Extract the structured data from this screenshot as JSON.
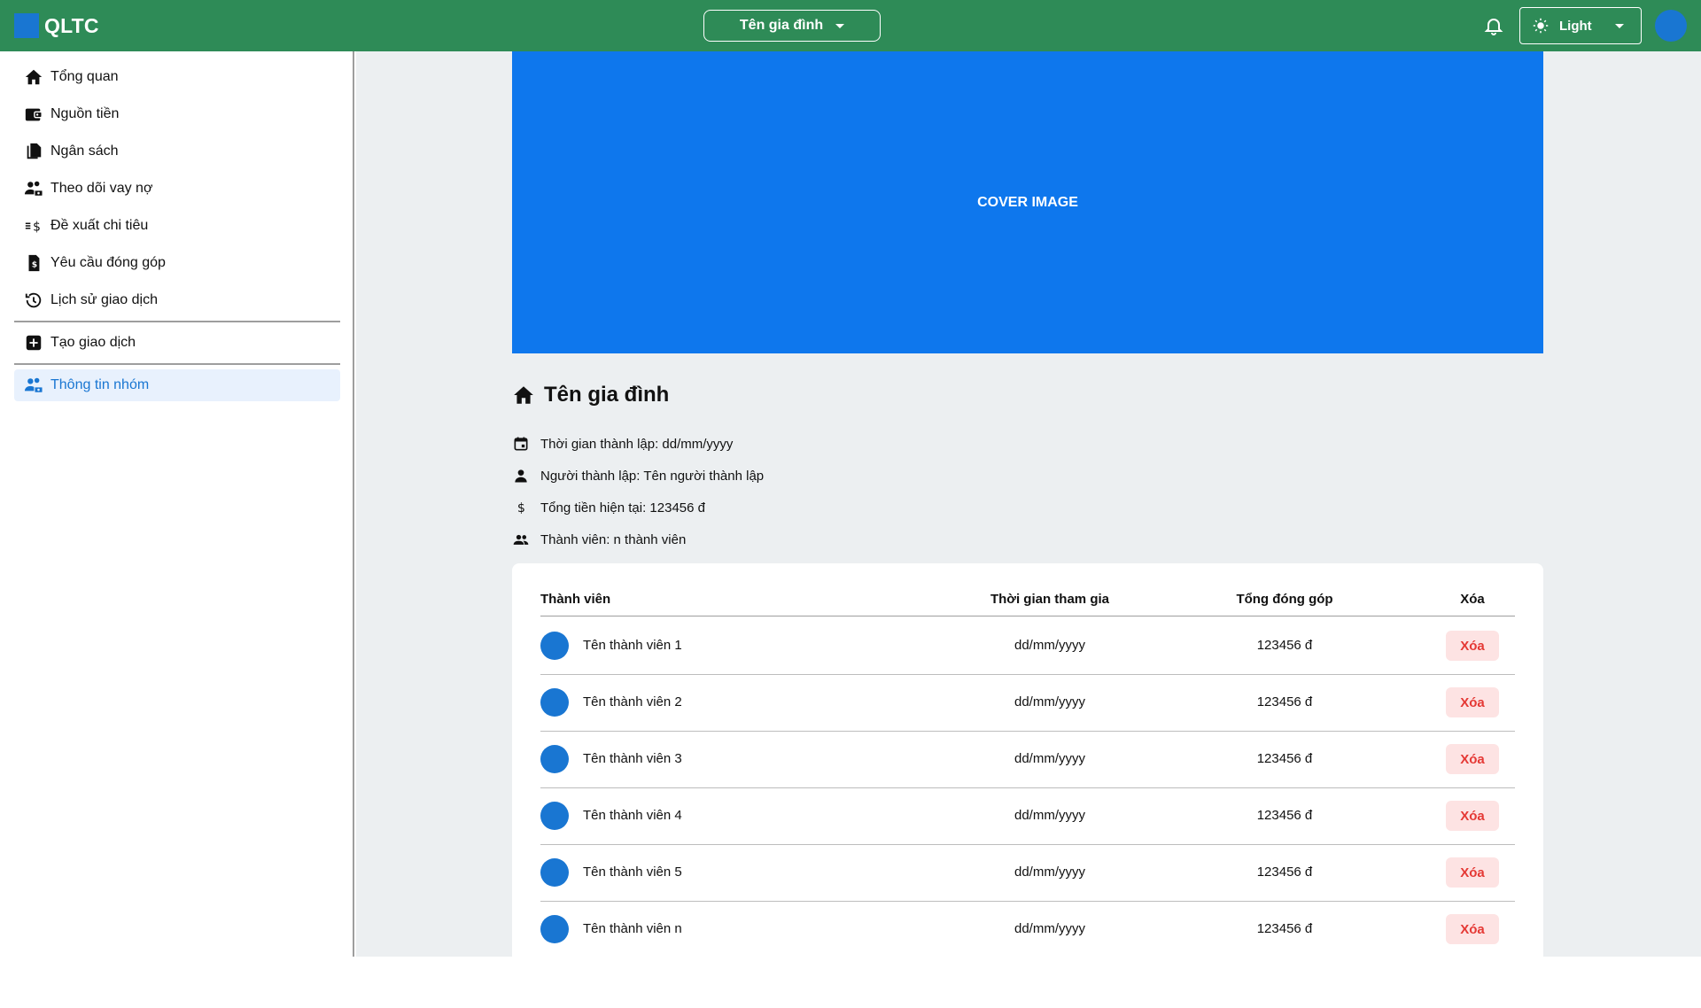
{
  "app": {
    "logo_text": "QLTC"
  },
  "header": {
    "family_select": "Tên gia đình",
    "theme_select": "Light"
  },
  "sidebar": {
    "items": [
      {
        "label": "Tổng quan",
        "icon": "home-icon"
      },
      {
        "label": "Nguồn tiền",
        "icon": "wallet-icon"
      },
      {
        "label": "Ngân sách",
        "icon": "copy-icon"
      },
      {
        "label": "Theo dõi vay nợ",
        "icon": "people-money-icon"
      },
      {
        "label": "Đề xuất chi tiêu",
        "icon": "list-dollar-icon"
      },
      {
        "label": "Yêu cầu đóng góp",
        "icon": "money-doc-icon"
      },
      {
        "label": "Lịch sử giao dịch",
        "icon": "history-icon"
      },
      {
        "label": "Tạo giao dịch",
        "icon": "add-box-icon"
      },
      {
        "label": "Thông tin nhóm",
        "icon": "group-icon",
        "active": true
      }
    ]
  },
  "main": {
    "cover_label": "COVER IMAGE",
    "group_name": "Tên gia đình",
    "info": {
      "founded": "Thời gian thành lập: dd/mm/yyyy",
      "founder": "Người thành lập: Tên người thành lập",
      "total": "Tổng tiền hiện tại: 123456 đ",
      "members": "Thành viên: n thành viên"
    },
    "table": {
      "headers": {
        "member": "Thành viên",
        "joined": "Thời gian tham gia",
        "contribution": "Tổng đóng góp",
        "delete": "Xóa"
      },
      "rows": [
        {
          "name": "Tên thành viên 1",
          "joined": "dd/mm/yyyy",
          "contribution": "123456 đ",
          "action": "Xóa"
        },
        {
          "name": "Tên thành viên 2",
          "joined": "dd/mm/yyyy",
          "contribution": "123456 đ",
          "action": "Xóa"
        },
        {
          "name": "Tên thành viên 3",
          "joined": "dd/mm/yyyy",
          "contribution": "123456 đ",
          "action": "Xóa"
        },
        {
          "name": "Tên thành viên 4",
          "joined": "dd/mm/yyyy",
          "contribution": "123456 đ",
          "action": "Xóa"
        },
        {
          "name": "Tên thành viên 5",
          "joined": "dd/mm/yyyy",
          "contribution": "123456 đ",
          "action": "Xóa"
        },
        {
          "name": "Tên thành viên n",
          "joined": "dd/mm/yyyy",
          "contribution": "123456 đ",
          "action": "Xóa"
        }
      ]
    }
  },
  "colors": {
    "header_bg": "#2e8b57",
    "accent": "#1976d2",
    "cover_bg": "#0e77ed",
    "delete_bg": "#fde3e3",
    "delete_text": "#e53935"
  }
}
